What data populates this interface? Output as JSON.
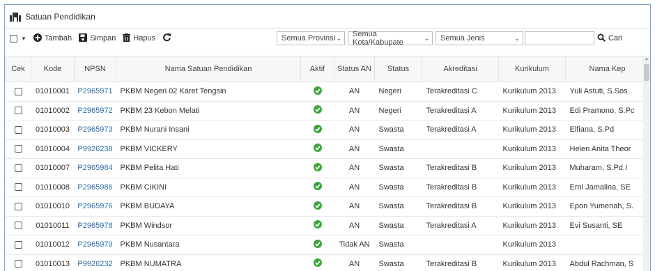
{
  "panel": {
    "title": "Satuan Pendidikan",
    "title_icon": "school-building-icon"
  },
  "toolbar": {
    "add_label": "Tambah",
    "save_label": "Simpan",
    "delete_label": "Hapus",
    "refresh_icon": "refresh-icon",
    "filters": {
      "province": "Semua Provinsi",
      "city": "Semua Kota/Kabupate",
      "type": "Semua Jenis"
    },
    "search": {
      "value": "",
      "placeholder": ""
    },
    "search_label": "Cari"
  },
  "colors": {
    "accent_border": "#7fa6d6",
    "link": "#2e6da4",
    "ok_green": "#3aa53a"
  },
  "table": {
    "columns": [
      "Cek",
      "Kode",
      "NPSN",
      "Nama Satuan Pendidikan",
      "Aktif",
      "Status AN",
      "Status",
      "Akreditasi",
      "Kurikulum",
      "Nama Kep"
    ],
    "rows": [
      {
        "kode": "01010001",
        "npsn": "P2965971",
        "nama": "PKBM Negeri 02 Karet Tengsin",
        "aktif": true,
        "status_an": "AN",
        "status": "Negeri",
        "akreditasi": "Terakreditasi C",
        "kurikulum": "Kurikulum 2013",
        "kepala": "Yuli Astuti, S.Sos"
      },
      {
        "kode": "01010002",
        "npsn": "P2965972",
        "nama": "PKBM 23 Kebon Melati",
        "aktif": true,
        "status_an": "AN",
        "status": "Negeri",
        "akreditasi": "Terakreditasi A",
        "kurikulum": "Kurikulum 2013",
        "kepala": "Edi Pramono, S.Pc"
      },
      {
        "kode": "01010003",
        "npsn": "P2965973",
        "nama": "PKBM Nurani Insani",
        "aktif": true,
        "status_an": "AN",
        "status": "Swasta",
        "akreditasi": "Terakreditasi A",
        "kurikulum": "Kurikulum 2013",
        "kepala": "Elfiana, S.Pd"
      },
      {
        "kode": "01010004",
        "npsn": "P9926238",
        "nama": "PKBM VICKERY",
        "aktif": true,
        "status_an": "AN",
        "status": "Swasta",
        "akreditasi": "",
        "kurikulum": "Kurikulum 2013",
        "kepala": "Helen Anita Theor"
      },
      {
        "kode": "01010007",
        "npsn": "P2965984",
        "nama": "PKBM Pelita Hati",
        "aktif": true,
        "status_an": "AN",
        "status": "Swasta",
        "akreditasi": "Terakreditasi B",
        "kurikulum": "Kurikulum 2013",
        "kepala": "Muharam, S.Pd.I"
      },
      {
        "kode": "01010008",
        "npsn": "P2965986",
        "nama": "PKBM CIKINI",
        "aktif": true,
        "status_an": "AN",
        "status": "Swasta",
        "akreditasi": "Terakreditasi B",
        "kurikulum": "Kurikulum 2013",
        "kepala": "Erni Jamalina, SE"
      },
      {
        "kode": "01010010",
        "npsn": "P2965976",
        "nama": "PKBM BUDAYA",
        "aktif": true,
        "status_an": "AN",
        "status": "Swasta",
        "akreditasi": "Terakreditasi B",
        "kurikulum": "Kurikulum 2013",
        "kepala": "Epon Yumenah, S."
      },
      {
        "kode": "01010011",
        "npsn": "P2965978",
        "nama": "PKBM Windsor",
        "aktif": true,
        "status_an": "AN",
        "status": "Swasta",
        "akreditasi": "Terakreditasi A",
        "kurikulum": "Kurikulum 2013",
        "kepala": "Evi Susanti, SE"
      },
      {
        "kode": "01010012",
        "npsn": "P2965979",
        "nama": "PKBM Nusantara",
        "aktif": true,
        "status_an": "Tidak AN",
        "status": "Swasta",
        "akreditasi": "",
        "kurikulum": "Kurikulum 2013",
        "kepala": ""
      },
      {
        "kode": "01010013",
        "npsn": "P9926232",
        "nama": "PKBM NUMATRA",
        "aktif": true,
        "status_an": "AN",
        "status": "Swasta",
        "akreditasi": "Terakreditasi B",
        "kurikulum": "Kurikulum 2013",
        "kepala": "Abdul Rachman, S"
      }
    ]
  }
}
